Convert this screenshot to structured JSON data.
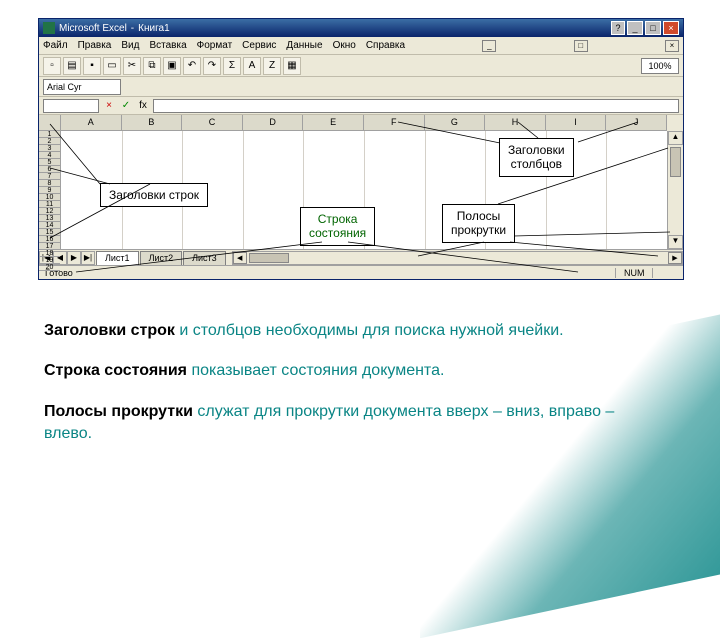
{
  "window": {
    "app": "Microsoft Excel",
    "doc": "Книга1",
    "help_btn": "?",
    "minimize": "_",
    "maximize": "□",
    "close": "×"
  },
  "menu": [
    "Файл",
    "Правка",
    "Вид",
    "Вставка",
    "Формат",
    "Сервис",
    "Данные",
    "Окно",
    "Справка"
  ],
  "zoom": "100%",
  "font": "Arial Cyr",
  "formula": {
    "cancel": "×",
    "accept": "✓",
    "fx": "fx"
  },
  "columns": [
    "A",
    "B",
    "C",
    "D",
    "E",
    "F",
    "G",
    "H",
    "I",
    "J"
  ],
  "rows": [
    "1",
    "2",
    "3",
    "4",
    "5",
    "6",
    "7",
    "8",
    "9",
    "10",
    "11",
    "12",
    "13",
    "14",
    "15",
    "16",
    "17",
    "18",
    "19",
    "20"
  ],
  "tabs": {
    "t1": "Лист1",
    "t2": "Лист2",
    "t3": "Лист3"
  },
  "status": {
    "ready": "Готово",
    "num": "NUM"
  },
  "callouts": {
    "row_headers": "Заголовки строк",
    "col_headers_l1": "Заголовки",
    "col_headers_l2": "столбцов",
    "statusbar_l1": "Строка",
    "statusbar_l2": "состояния",
    "scroll_l1": "Полосы",
    "scroll_l2": "прокрутки"
  },
  "explain": {
    "p1a": "Заголовки строк",
    "p1b": " и столбцов",
    "p1c": " необходимы для поиска нужной ячейки.",
    "p2a": "Строка состояния",
    "p2b": " показывает состояния документа.",
    "p3a": "Полосы прокрутки",
    "p3b": " служат для прокрутки документа вверх – вниз, вправо – влево."
  }
}
